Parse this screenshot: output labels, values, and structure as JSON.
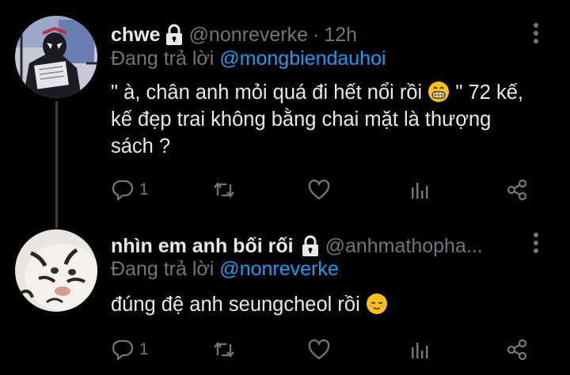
{
  "tweets": [
    {
      "display_name": "chwe",
      "handle": "@nonreverke",
      "separator": "·",
      "time": "12h",
      "replying_prefix": "Đang trả lời",
      "replying_to": "@mongbiendauhoi",
      "text_before_emoji": "\" à, chân anh mỏi quá đi hết nổi rồi ",
      "emoji": "grinning-face-with-smiling-eyes",
      "text_after_emoji": " \" 72 kế, kế đẹp trai không bằng chai mặt là thượng sách ?",
      "reply_count": "1",
      "avatar": "spider-man-comic-avatar",
      "protected": true
    },
    {
      "display_name": "nhìn em anh bối rối",
      "handle": "@anhmathopha...",
      "replying_prefix": "Đang trả lời",
      "replying_to": "@nonreverke",
      "text_before_emoji": "đúng đệ anh seungcheol rồi ",
      "emoji": "relieved-face",
      "reply_count": "1",
      "avatar": "white-tiger-plush-avatar",
      "protected": true
    }
  ],
  "icons": {
    "lock": "lock-icon",
    "more": "more-vertical-icon",
    "reply": "reply-bubble-icon",
    "retweet": "retweet-icon",
    "like": "heart-icon",
    "stats": "bar-chart-icon",
    "share": "share-icon"
  },
  "colors": {
    "background": "#000000",
    "text_primary": "#e7e9ea",
    "text_secondary": "#71767b",
    "link": "#1d9bf0",
    "thread_line": "#3a3f44"
  }
}
